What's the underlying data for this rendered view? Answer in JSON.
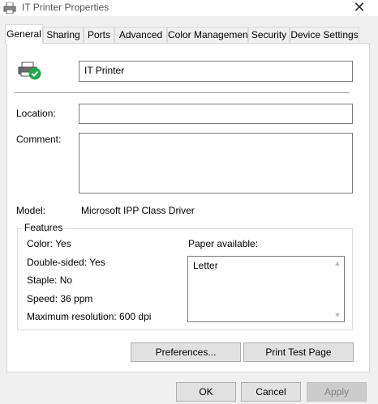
{
  "window": {
    "title": "IT Printer Properties",
    "close_glyph": "✕"
  },
  "tabs": [
    {
      "label": "General",
      "active": true
    },
    {
      "label": "Sharing",
      "active": false
    },
    {
      "label": "Ports",
      "active": false
    },
    {
      "label": "Advanced",
      "active": false
    },
    {
      "label": "Color Management",
      "active": false
    },
    {
      "label": "Security",
      "active": false
    },
    {
      "label": "Device Settings",
      "active": false
    }
  ],
  "general": {
    "printer_name": "IT Printer",
    "location_label": "Location:",
    "location_value": "",
    "comment_label": "Comment:",
    "comment_value": "",
    "model_label": "Model:",
    "model_value": "Microsoft IPP Class Driver"
  },
  "features": {
    "title": "Features",
    "color": "Color: Yes",
    "double_sided": "Double-sided: Yes",
    "staple": "Staple: No",
    "speed": "Speed: 36 ppm",
    "max_resolution": "Maximum resolution: 600 dpi",
    "paper_label": "Paper available:",
    "papers": [
      "Letter"
    ]
  },
  "buttons": {
    "preferences": "Preferences...",
    "print_test_page": "Print Test Page",
    "ok": "OK",
    "cancel": "Cancel",
    "apply": "Apply"
  },
  "colors": {
    "status_ok": "#1fa84a",
    "panel_bg": "#ffffff",
    "window_bg": "#f0f0f0"
  }
}
